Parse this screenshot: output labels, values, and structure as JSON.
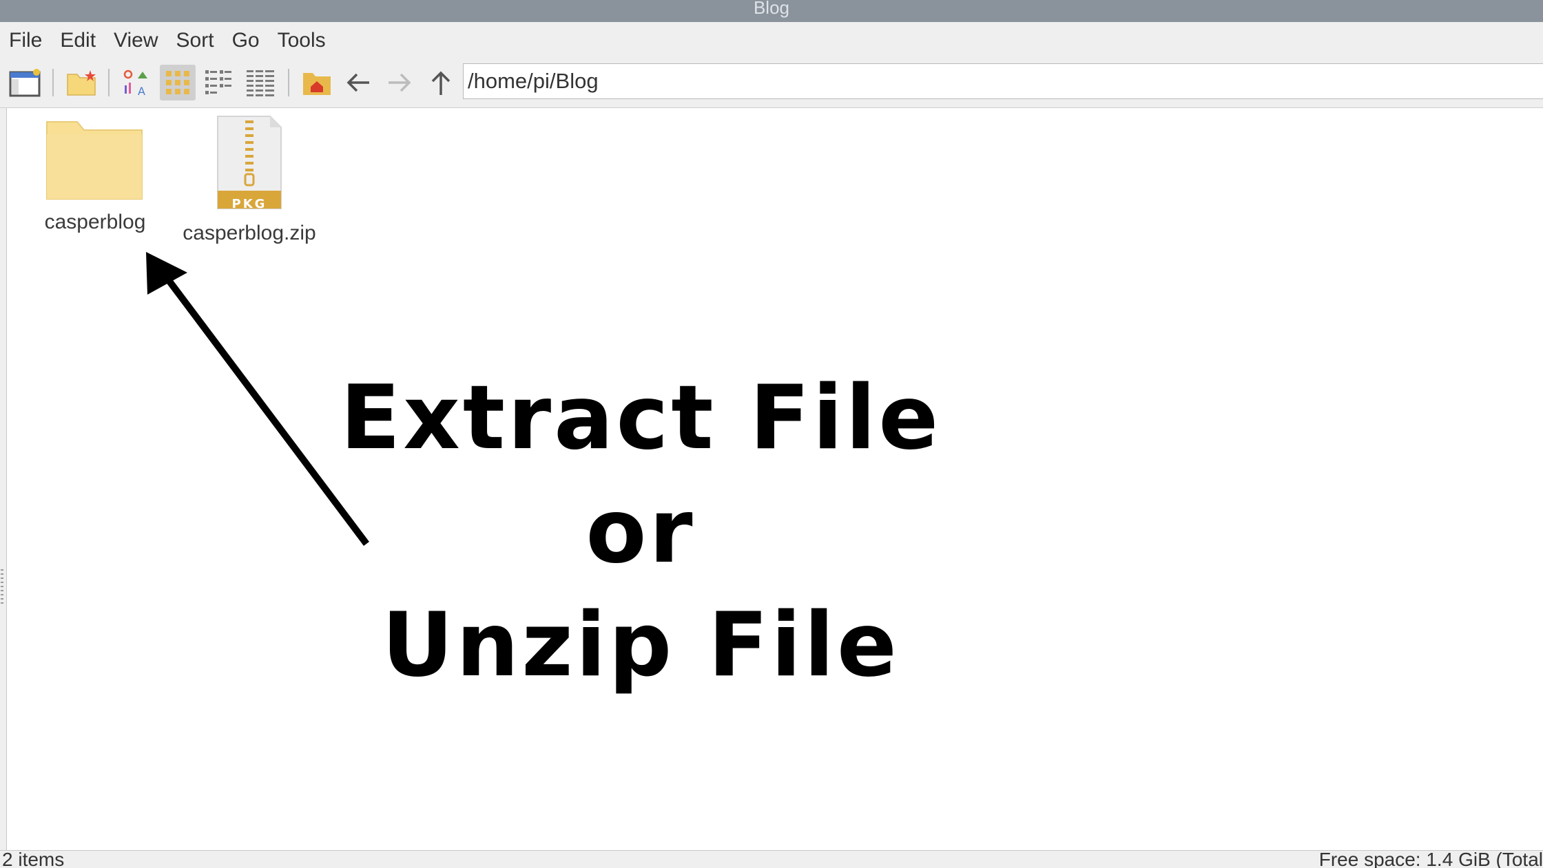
{
  "window": {
    "title": "Blog"
  },
  "menu": [
    "File",
    "Edit",
    "View",
    "Sort",
    "Go",
    "Tools"
  ],
  "toolbar": {
    "buttons": [
      "new-window-icon",
      "new-folder-icon",
      "icon-view-icon",
      "thumbnail-view-icon",
      "compact-view-icon",
      "detailed-list-view-icon",
      "home-folder-icon",
      "back-arrow-icon",
      "forward-arrow-icon",
      "up-arrow-icon"
    ],
    "path": "/home/pi/Blog"
  },
  "files": [
    {
      "name": "casperblog",
      "type": "folder"
    },
    {
      "name": "casperblog.zip",
      "type": "zip",
      "badge": "PKG"
    }
  ],
  "annotation": {
    "line1": "Extract File",
    "line2": "or",
    "line3": "Unzip File"
  },
  "status": {
    "items": "2 items",
    "free_space": "Free space: 1.4 GiB (Total"
  },
  "colors": {
    "titlebar": "#8a929c",
    "folder": "#f8df94",
    "zip_badge": "#d9a63a",
    "home_icon": "#e8b94a"
  }
}
